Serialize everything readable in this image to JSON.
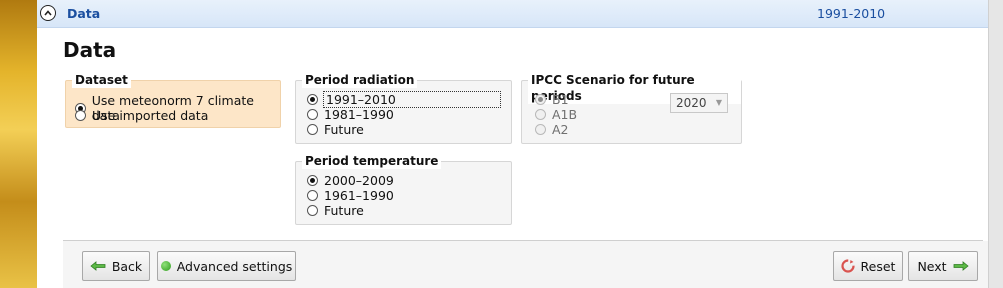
{
  "header": {
    "title": "Data",
    "period": "1991-2010"
  },
  "page": {
    "title": "Data"
  },
  "dataset": {
    "title": "Dataset",
    "options": [
      "Use meteonorm 7 climate data",
      "Use imported data"
    ],
    "selected": 0
  },
  "period_radiation": {
    "title": "Period radiation",
    "options": [
      "1991–2010",
      "1981–1990",
      "Future"
    ],
    "selected": 0
  },
  "period_temperature": {
    "title": "Period temperature",
    "options": [
      "2000–2009",
      "1961–1990",
      "Future"
    ],
    "selected": 0
  },
  "ipcc": {
    "title": "IPCC Scenario for future periods",
    "options": [
      "B1",
      "A1B",
      "A2"
    ],
    "selected": 0,
    "year": "2020"
  },
  "buttons": {
    "back": "Back",
    "advanced": "Advanced settings",
    "reset": "Reset",
    "next": "Next"
  },
  "icons": {
    "collapse": "chevron-up-circle-icon",
    "back": "arrow-left-icon",
    "advanced": "green-dot-icon",
    "reset": "reset-icon",
    "next": "arrow-right-icon"
  },
  "colors": {
    "header_bg": "#dce9f8",
    "header_text": "#1b4fa0",
    "dataset_bg": "#fde6c8",
    "arrow_green": "#4caf3a",
    "reset_red": "#d9534f"
  }
}
